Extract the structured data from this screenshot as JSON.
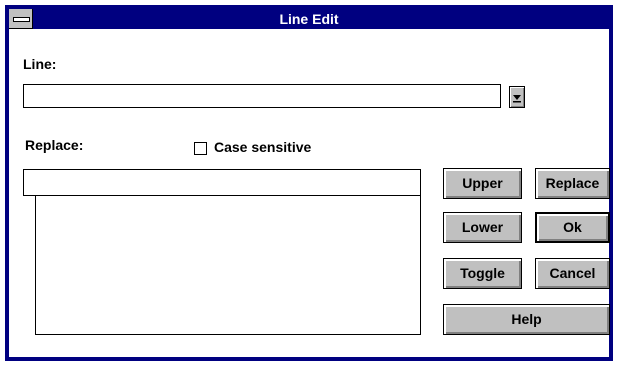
{
  "window": {
    "title": "Line Edit"
  },
  "line": {
    "label": "Line:",
    "value": ""
  },
  "replace": {
    "label": "Replace:",
    "value": "",
    "case_sensitive_label": "Case sensitive",
    "case_sensitive_checked": false
  },
  "buttons": {
    "upper": "Upper",
    "replace": "Replace",
    "lower": "Lower",
    "ok": "Ok",
    "toggle": "Toggle",
    "cancel": "Cancel",
    "help": "Help"
  },
  "icons": {
    "system_menu": "system-menu-icon",
    "dropdown": "dropdown-arrow-icon"
  }
}
